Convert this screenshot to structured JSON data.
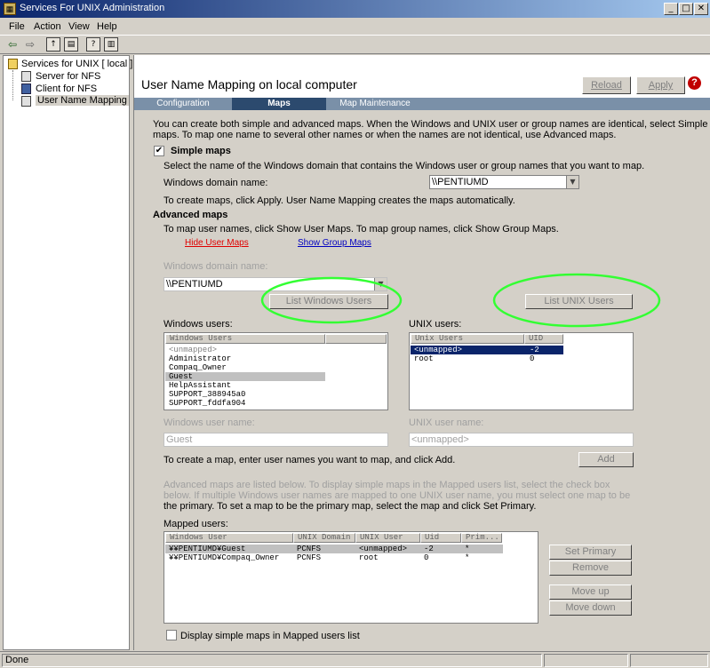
{
  "window": {
    "title": "Services For UNIX Administration",
    "min": "_",
    "max": "□",
    "close": "✕"
  },
  "menu": [
    "File",
    "Action",
    "View",
    "Help"
  ],
  "toolbar": {
    "back": "⇦",
    "forward": "⇨"
  },
  "tree": {
    "root": "Services for UNIX [ local ]",
    "children": [
      "Server for NFS",
      "Client for NFS",
      "User Name Mapping"
    ]
  },
  "header": {
    "title": "User Name Mapping on local computer",
    "reload": "Reload",
    "apply": "Apply",
    "help": "?"
  },
  "tabs": [
    "Configuration",
    "Maps",
    "Map Maintenance"
  ],
  "intro": [
    "You can create both simple and advanced maps. When the Windows and UNIX user or group names are identical, select Simple",
    "maps. To map one name to several other names or when the names are not identical, use Advanced maps."
  ],
  "simple": {
    "checkbox_label": "Simple maps",
    "checked": "✔",
    "desc": "Select the name of the Windows domain that contains the Windows user or group names that you want to map.",
    "domain_label": "Windows domain name:",
    "domain_value": "\\\\PENTIUMD",
    "apply_note": "To create maps, click Apply. User Name Mapping creates the maps automatically."
  },
  "advanced": {
    "heading": "Advanced maps",
    "desc": "To map user names, click Show User Maps. To map group names, click Show Group Maps.",
    "hide_user_maps": "Hide User Maps",
    "show_group_maps": "Show Group Maps",
    "domain_label": "Windows domain name:",
    "domain_value": "\\\\PENTIUMD",
    "list_windows_users": "List Windows Users",
    "list_unix_users": "List UNIX Users",
    "windows_users_label": "Windows users:",
    "unix_users_label": "UNIX users:",
    "windows_users_header": "Windows Users",
    "windows_users": [
      "<unmapped>",
      "Administrator",
      "Compaq_Owner",
      "Guest",
      "HelpAssistant",
      "SUPPORT_388945a0",
      "SUPPORT_fddfa904"
    ],
    "unix_users_headers": [
      "Unix Users",
      "UID"
    ],
    "unix_users": [
      [
        "<unmapped>",
        "-2"
      ],
      [
        "root",
        "0"
      ]
    ],
    "win_user_name_label": "Windows user name:",
    "win_user_name_value": "Guest",
    "unix_user_name_label": "UNIX user name:",
    "unix_user_name_value": "<unmapped>",
    "create_note": "To create a map, enter user names you want to map, and click Add.",
    "add": "Add",
    "listed_note": [
      "Advanced maps are listed below. To display simple maps in the Mapped users list, select the check box",
      "below. If multiple Windows user names are mapped to one UNIX user name, you must select one map to be",
      "the primary. To set a map to be the primary map, select the map and click Set Primary."
    ],
    "mapped_label": "Mapped users:",
    "mapped_headers": [
      "Windows User",
      "UNIX Domain",
      "UNIX User",
      "Uid",
      "Prim..."
    ],
    "mapped_rows": [
      [
        "¥¥PENTIUMD¥Guest",
        "PCNFS",
        "<unmapped>",
        "-2",
        "*"
      ],
      [
        "¥¥PENTIUMD¥Compaq_Owner",
        "PCNFS",
        "root",
        "0",
        "*"
      ]
    ],
    "set_primary": "Set Primary",
    "remove": "Remove",
    "move_up": "Move up",
    "move_down": "Move down",
    "display_simple": "Display simple maps in Mapped users list"
  },
  "status": {
    "text": "Done"
  },
  "colors": {
    "highlight": "#33ff33"
  }
}
